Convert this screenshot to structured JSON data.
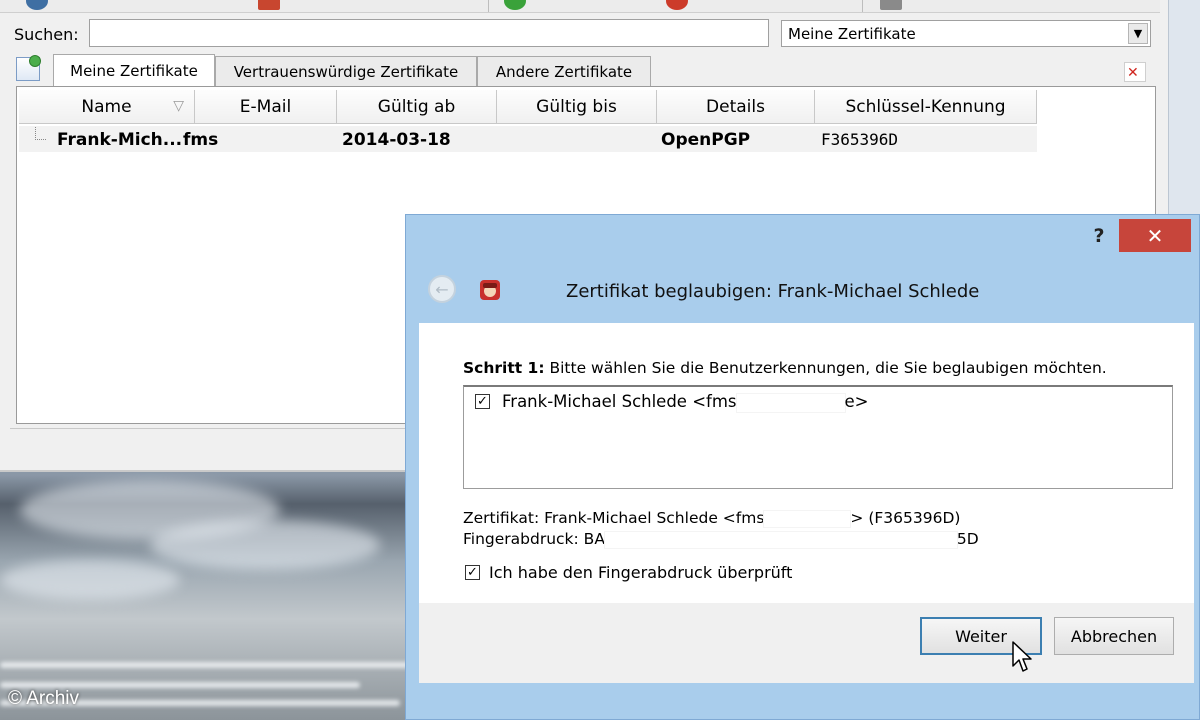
{
  "desktop": {
    "copyright": "© Archiv"
  },
  "main_window": {
    "search": {
      "label": "Suchen:",
      "value": "",
      "filter_selected": "Meine Zertifikate"
    },
    "tabs": [
      {
        "label": "Meine Zertifikate",
        "active": true
      },
      {
        "label": "Vertrauenswürdige Zertifikate",
        "active": false
      },
      {
        "label": "Andere Zertifikate",
        "active": false
      }
    ],
    "columns": [
      "Name",
      "E-Mail",
      "Gültig ab",
      "Gültig bis",
      "Details",
      "Schlüssel-Kennung"
    ],
    "rows": [
      {
        "name": "Frank-Mich...",
        "email": "fms",
        "valid_from": "2014-03-18",
        "valid_until": "",
        "details": "OpenPGP",
        "key_id": "F365396D"
      }
    ]
  },
  "dialog": {
    "help": "?",
    "close": "✕",
    "title": "Zertifikat beglaubigen: Frank-Michael Schlede",
    "step_bold": "Schritt 1:",
    "step_text": " Bitte wählen Sie die Benutzerkennungen, die Sie beglaubigen möchten.",
    "user_ids": [
      {
        "checked": true,
        "prefix": "Frank-Michael Schlede <fms",
        "suffix": "e>"
      }
    ],
    "cert_prefix": "Zertifikat: Frank-Michael Schlede <fms",
    "cert_suffix": "> (F365396D)",
    "fingerprint_prefix": "Fingerabdruck: BA",
    "fingerprint_suffix": "5D",
    "confirm_checked": true,
    "confirm_label": "Ich habe den Fingerabdruck überprüft",
    "buttons": {
      "next": "Weiter",
      "cancel": "Abbrechen"
    }
  }
}
